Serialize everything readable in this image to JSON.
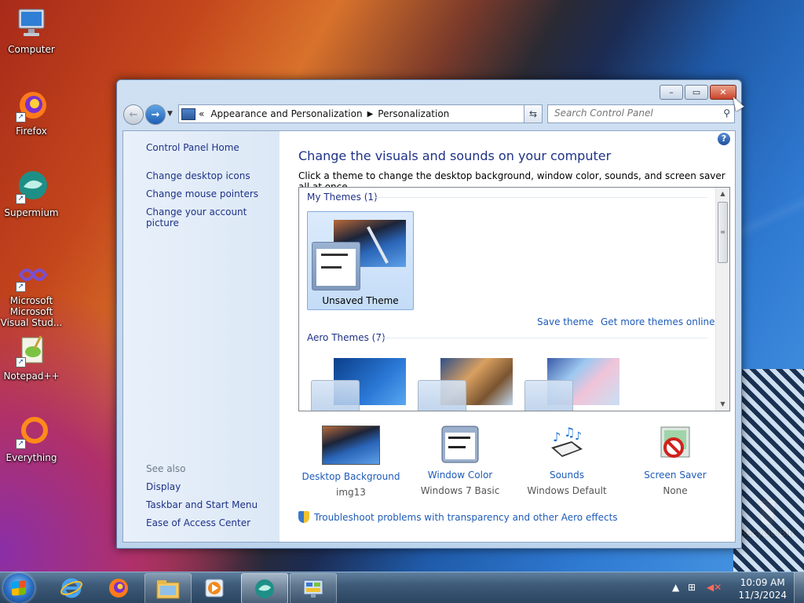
{
  "desktop": {
    "icons": [
      {
        "label": "Computer",
        "icon": "computer-icon"
      },
      {
        "label": "Firefox",
        "icon": "firefox-icon"
      },
      {
        "label": "Supermium",
        "icon": "supermium-icon"
      },
      {
        "label": "Microsoft Visual Stud...",
        "icon": "visual-studio-icon"
      },
      {
        "label": "Notepad++",
        "icon": "notepadpp-icon"
      },
      {
        "label": "Everything",
        "icon": "everything-icon"
      },
      {
        "label": "Recycle Bin",
        "icon": "recycle-bin-icon"
      }
    ]
  },
  "window": {
    "caption": {
      "minimize": "–",
      "maximize": "▭",
      "close": "✕"
    },
    "breadcrumb": {
      "prefix": "«",
      "items": [
        "Appearance and Personalization",
        "Personalization"
      ]
    },
    "search_placeholder": "Search Control Panel",
    "left_pane": {
      "home": "Control Panel Home",
      "links": [
        "Change desktop icons",
        "Change mouse pointers",
        "Change your account picture"
      ],
      "see_also_title": "See also",
      "see_also": [
        "Display",
        "Taskbar and Start Menu",
        "Ease of Access Center"
      ]
    },
    "main": {
      "heading": "Change the visuals and sounds on your computer",
      "subheading": "Click a theme to change the desktop background, window color, sounds, and screen saver all at once.",
      "my_themes_header": "My Themes (1)",
      "unsaved_theme": "Unsaved Theme",
      "save_theme": "Save theme",
      "get_more": "Get more themes online",
      "aero_header": "Aero Themes (7)",
      "bottom": [
        {
          "label": "Desktop Background",
          "value": "img13"
        },
        {
          "label": "Window Color",
          "value": "Windows 7 Basic"
        },
        {
          "label": "Sounds",
          "value": "Windows Default"
        },
        {
          "label": "Screen Saver",
          "value": "None"
        }
      ],
      "troubleshoot": "Troubleshoot problems with transparency and other Aero effects"
    }
  },
  "taskbar": {
    "clock_time": "10:09 AM",
    "clock_date": "11/3/2024",
    "buttons": [
      "internet-explorer-icon",
      "firefox-icon",
      "file-explorer-icon",
      "media-player-icon",
      "supermium-icon",
      "control-panel-icon"
    ]
  }
}
